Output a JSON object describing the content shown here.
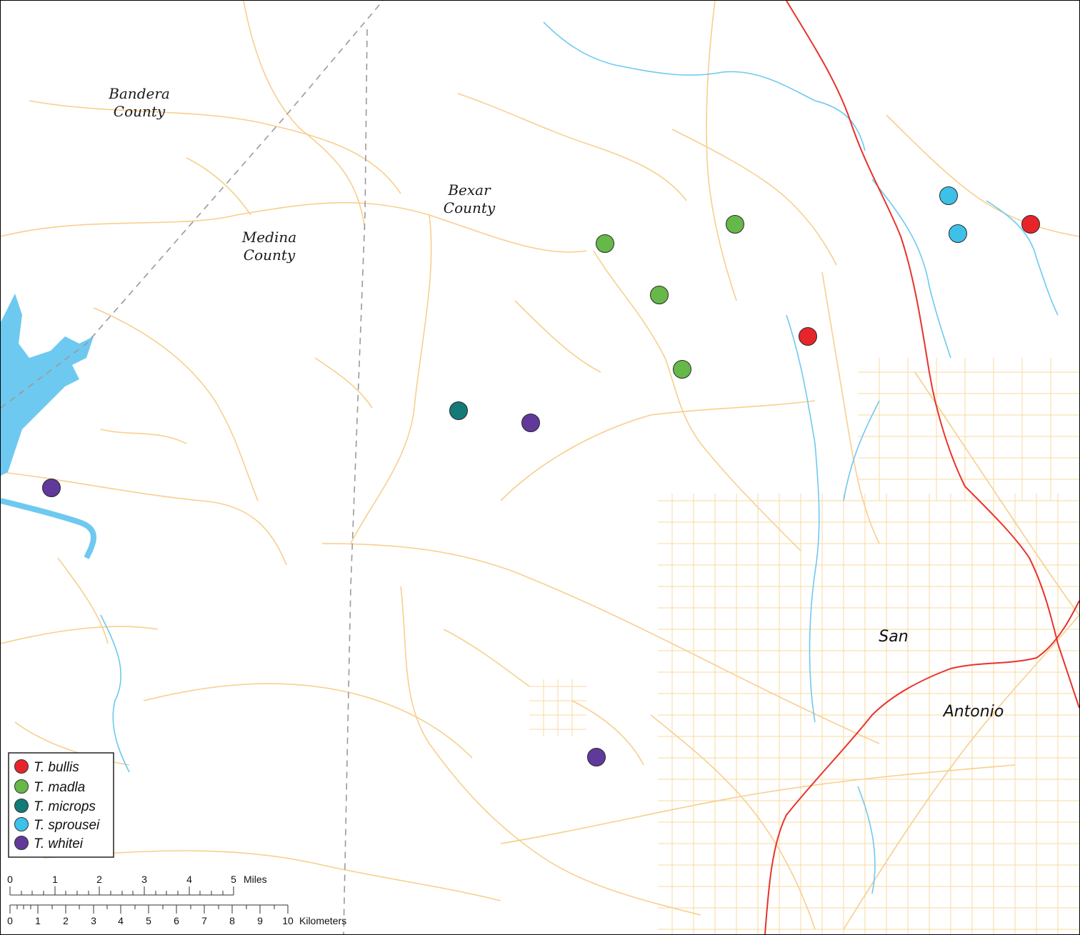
{
  "labels": {
    "bandera": [
      "Bandera",
      "County"
    ],
    "medina": [
      "Medina",
      "County"
    ],
    "bexar": [
      "Bexar",
      "County"
    ],
    "san": "San",
    "antonio": "Antonio"
  },
  "legend": [
    {
      "label": "T. bullis",
      "color": "#e8242b",
      "icon": "red-dot-icon"
    },
    {
      "label": "T. madla",
      "color": "#66b848",
      "icon": "green-dot-icon"
    },
    {
      "label": "T. microps",
      "color": "#137a78",
      "icon": "teal-dot-icon"
    },
    {
      "label": "T. sprousei",
      "color": "#3dc1e8",
      "icon": "cyan-dot-icon"
    },
    {
      "label": "T. whitei",
      "color": "#61399a",
      "icon": "purple-dot-icon"
    }
  ],
  "scale": {
    "miles_ticks": [
      "0",
      "1",
      "2",
      "3",
      "4",
      "5"
    ],
    "miles_unit": "Miles",
    "km_ticks": [
      "0",
      "1",
      "2",
      "3",
      "4",
      "5",
      "6",
      "7",
      "8",
      "9",
      "10"
    ],
    "km_unit": "Kilometers"
  },
  "colors": {
    "road": "#f6c77a",
    "highway": "#e8332b",
    "water": "#6ec9f0",
    "lake": "#6ec9f0",
    "boundary": "#9a9a9a"
  }
}
